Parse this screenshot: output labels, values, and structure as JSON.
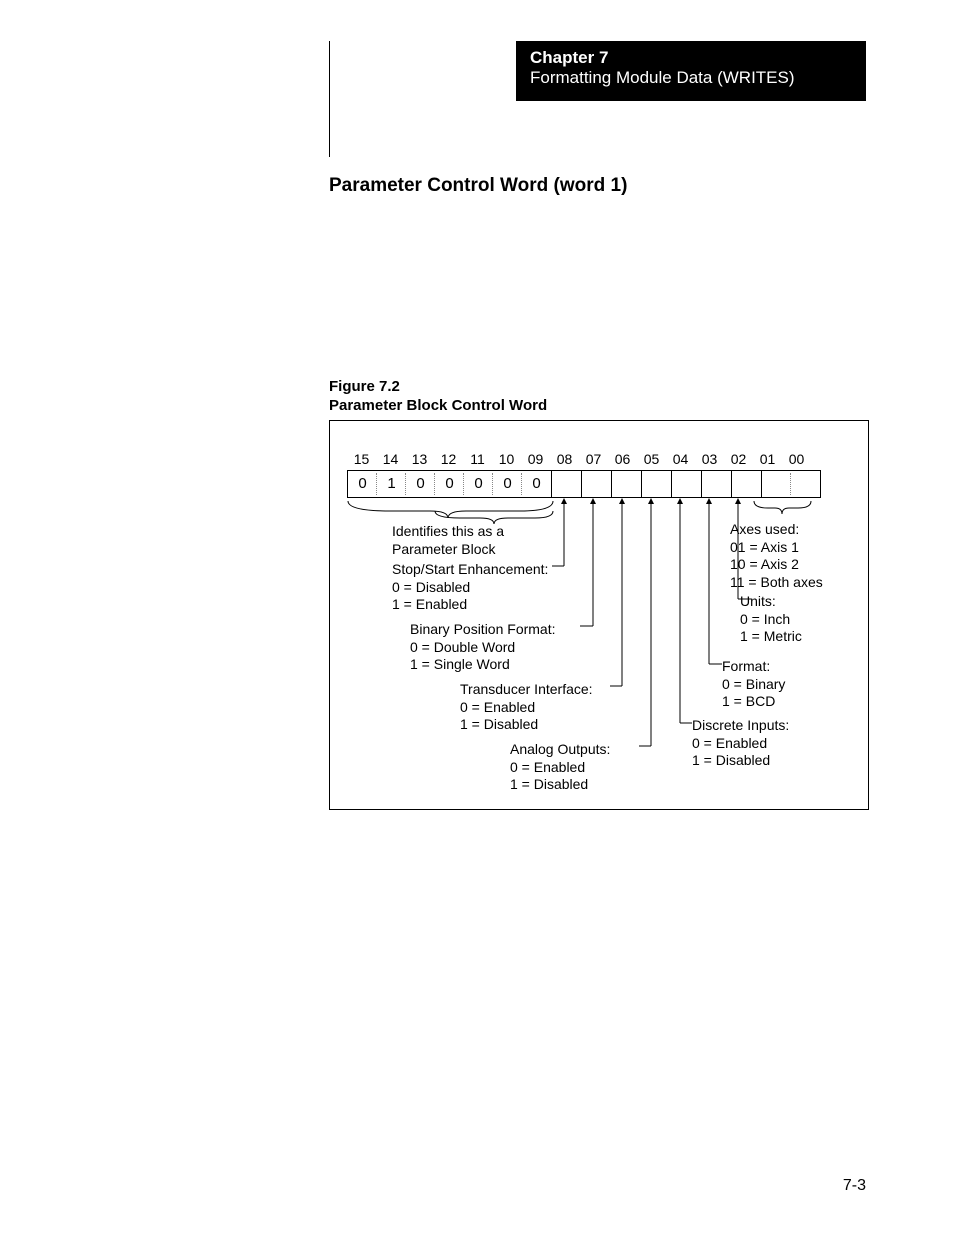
{
  "chapter": {
    "num": "Chapter 7",
    "title": "Formatting Module Data (WRITES)"
  },
  "section_title": "Parameter Control Word (word 1)",
  "figure": {
    "num": "Figure 7.2",
    "title": "Parameter Block Control Word"
  },
  "bits": {
    "headers": [
      "15",
      "14",
      "13",
      "12",
      "11",
      "10",
      "09",
      "08",
      "07",
      "06",
      "05",
      "04",
      "03",
      "02",
      "01",
      "00"
    ],
    "values": [
      "0",
      "1",
      "0",
      "0",
      "0",
      "0",
      "0",
      "",
      "",
      "",
      "",
      "",
      "",
      "",
      "",
      ""
    ]
  },
  "ann": {
    "identify": "Identifies this as a\nParameter Block",
    "stopstart": "Stop/Start Enhancement:\n0 = Disabled\n1 = Enabled",
    "binpos": "Binary Position Format:\n0 = Double Word\n1 = Single Word",
    "xducer": "Transducer Interface:\n0 = Enabled\n1 = Disabled",
    "aout": "Analog Outputs:\n0 = Enabled\n1 = Disabled",
    "axes": "Axes used:\n01 = Axis 1\n10 = Axis 2\n11 = Both axes",
    "units": "Units:\n0 = Inch\n1 = Metric",
    "format": "Format:\n0 = Binary\n1 = BCD",
    "din": "Discrete Inputs:\n0 = Enabled\n1 = Disabled"
  },
  "page_num": "7-3"
}
